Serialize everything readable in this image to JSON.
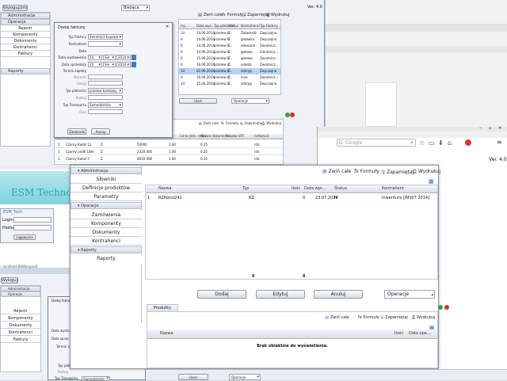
{
  "colors": {
    "accent": "#2f6fb3",
    "selected_row": "#b8d4f0",
    "esm_logo": "#1fa6b5",
    "close_red": "#d9302c",
    "add_green": "#3aa23a"
  },
  "back_window": {
    "title_button": "Wyloguj/zmień",
    "version": "Ver. 4.0",
    "period_select": "Bieżąca",
    "sidebar": {
      "admin": "Administracja",
      "operations": "Operacje",
      "items": [
        "Rejestr",
        "Komponenty",
        "Dokumenty",
        "Kontrahenci",
        "Faktury"
      ],
      "reports": "Raporty"
    },
    "toolbar": {
      "collapse": "Zwiń całe",
      "formulas": "Formuły",
      "remember": "Zapamiętaj",
      "print": "Wydrukuj"
    },
    "table_headers": [
      "ms...",
      "Data wys...",
      "Typ płatności",
      "Status",
      "Kontrahenci",
      "Typ Faktury"
    ],
    "rows": [
      [
        "14",
        "14.06.2014",
        "przelew b...",
        "Z",
        "Zatwierdz",
        "Zwyczajna"
      ],
      [
        "0",
        "14.06.2014",
        "przelew b...",
        "Z",
        "gotówka",
        "Zwyczajna"
      ],
      [
        "0",
        "14.06.2014",
        "przelew b...",
        "Z",
        "odroczon",
        "Zwrotnicz..."
      ],
      [
        "0",
        "14.06.2014",
        "przelew b...",
        "Z",
        "gotowa",
        "Zwrotnicz..."
      ],
      [
        "0",
        "15.06.2014",
        "przelew b...",
        "Z",
        "gotowa",
        "Zwrotnicz..."
      ],
      [
        "0",
        "16.06.2014",
        "przelew b...",
        "Z",
        "sobota",
        "Zwrotnicz..."
      ],
      [
        "14",
        "02.06.2014",
        "przelew b...",
        "Z",
        "zdaryg",
        "Zwyczajna"
      ],
      [
        "0",
        "16.04.2014",
        "przelew b...",
        "Z",
        "inne",
        "Zwrotnicz..."
      ],
      [
        "14",
        "15.04.2014",
        "przelew b...",
        "Z",
        "zdaryg",
        "Zwyczajna"
      ]
    ],
    "bottom_buttons": [
      "Usuń",
      "Operacje"
    ],
    "lower_table_headers": [
      "Cena jedn. netto",
      "Wart.",
      "Cena jedn. netto",
      "Nazwa dokumentu",
      "Stawka VAT",
      "netto/vat"
    ],
    "lower_rows": [
      [
        "1",
        "Czarny Kwiat 12",
        "Z",
        "50000",
        "1.00",
        "0.25",
        "nfo"
      ],
      [
        "1",
        "Czarny profil 18m",
        "Z",
        "2320 000",
        "1.00",
        "0.25",
        "nfo"
      ],
      [
        "1",
        "Czarny Kwiat 5",
        "Z",
        "4610 000",
        "1.00",
        "0.25",
        "nfo"
      ]
    ]
  },
  "dialog": {
    "title": "Dodaj fakturę",
    "labels": [
      "Typ Faktury",
      "Kontrahent",
      "Data",
      "Data wystawienia",
      "Data sprzedaży",
      "Termin zapłaty",
      "Wartość",
      "Uwagi",
      "Typ płatności",
      "Rodzaj",
      "Typ Transportu",
      "Opis"
    ],
    "invoice_type": "Zwrotnicz kupowa",
    "issue_day": "14",
    "issue_month": "Sie",
    "issue_year": "2014",
    "sale_day": "14",
    "sale_month": "Sie",
    "sale_year": "2014",
    "payment_type": "przelew bankowy",
    "transport_type": "Samodzielnie",
    "ok_label": "Zatwierdź",
    "cancel_label": "Anuluj"
  },
  "browser": {
    "search_placeholder": "Google",
    "version": "Ver. 4.0"
  },
  "login": {
    "logo_text": "ESM Techno",
    "link": "ESM_Tech",
    "user_label": "Login",
    "pass_label": "Hasło",
    "user_value": "Login",
    "submit": "Logowanie",
    "url": "localhost:8080/eyesl2"
  },
  "front": {
    "sidebar": {
      "admin_header": "Administracja",
      "admin_items": [
        "Słowniki",
        "Definicje produktów",
        "Parametry"
      ],
      "ops_header": "Operacje",
      "ops_items": [
        "Zamówienia",
        "Komponenty",
        "Dokumenty",
        "Kontrahenci"
      ],
      "reports_header": "Raporty",
      "reports_items": [
        "Raporty"
      ]
    },
    "toolbar": {
      "collapse": "Zwiń całe",
      "formulas": "Formuły",
      "remember": "Zapamiętaj",
      "print": "Wydrukuj"
    },
    "table": {
      "headers": [
        "Nazwa",
        "Typ",
        "Ilość",
        "Data wpr...",
        "Status",
        "Kontrahent"
      ],
      "rows": [
        [
          "1",
          "RZKonsi241",
          "RZ",
          "0",
          "23.07.2014",
          "N",
          "Inwentura [INV07 2014]"
        ]
      ],
      "footer": [
        "0",
        "0"
      ]
    },
    "buttons": {
      "add": "Dodaj",
      "edit": "Edytuj",
      "cancel": "Anuluj",
      "operations": "Operacje"
    },
    "products": {
      "tab": "Produkty",
      "headers": [
        "Nazwa",
        "Ilość",
        "Data ope..."
      ],
      "empty": "Brak obiektów do wyświetlenia."
    }
  },
  "bottom_left": {
    "title_button": "Wyloguj/zm",
    "admin": "Administracja",
    "operations": "Operacje",
    "items": [
      "Rejestr",
      "Komponenty",
      "Dokumenty",
      "Kontrahenci",
      "Faktury"
    ],
    "dialog_title": "Dodaj fakturę",
    "labels": [
      "Data wysta",
      "Data sprze",
      "Termin za",
      "Typ płat",
      "Rodzaj",
      "Typ Transportu"
    ],
    "payment_value": "przelew b...",
    "transport_value": "Samodzielnie"
  },
  "bottom_strip": {
    "usun": "Usuń",
    "operacje": "Operacje"
  }
}
